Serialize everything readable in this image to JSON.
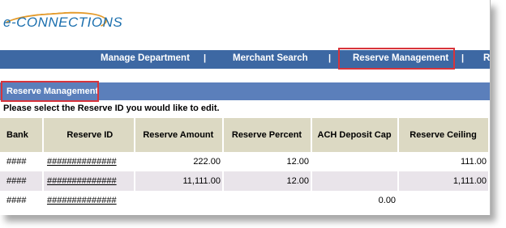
{
  "brand": {
    "logo_text": "e-CONNECTIONS"
  },
  "nav": {
    "items": [
      "Manage Department",
      "Merchant Search",
      "Reserve Management",
      "R"
    ],
    "separator": "|"
  },
  "section": {
    "title": "Reserve Management"
  },
  "instruction": "Please select the Reserve ID you would like to edit.",
  "table": {
    "headers": [
      "Bank",
      "Reserve ID",
      "Reserve Amount",
      "Reserve Percent",
      "ACH Deposit Cap",
      "Reserve Ceiling"
    ],
    "rows": [
      {
        "bank": "####",
        "reserve_id": "##############",
        "amount": "222.00",
        "percent": "12.00",
        "ach_cap": "",
        "ceiling": "111.00"
      },
      {
        "bank": "####",
        "reserve_id": "##############",
        "amount": "11,111.00",
        "percent": "12.00",
        "ach_cap": "",
        "ceiling": "1,111.00"
      },
      {
        "bank": "####",
        "reserve_id": "##############",
        "amount": "",
        "percent": "",
        "ach_cap": "0.00",
        "ceiling": ""
      }
    ]
  },
  "colors": {
    "nav_bg": "#3d68a3",
    "section_bg": "#5b7fbb",
    "header_bg": "#dcd9c3",
    "highlight": "#d8343b"
  }
}
